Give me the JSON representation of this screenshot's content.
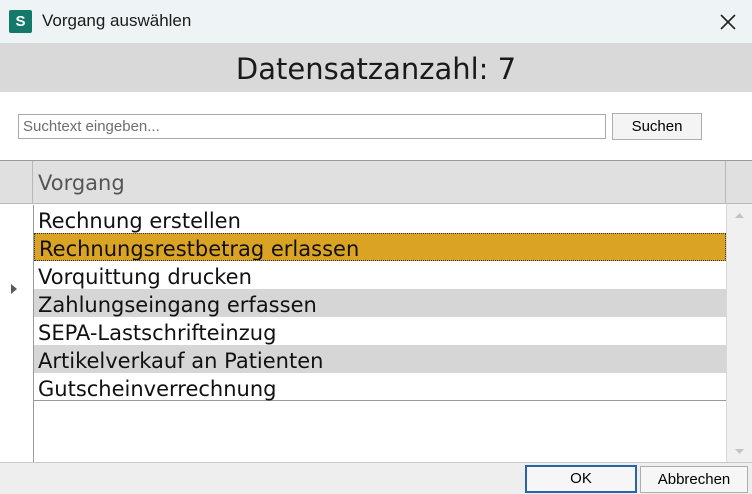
{
  "window": {
    "app_icon_letter": "S",
    "title": "Vorgang auswählen"
  },
  "header": {
    "record_count": "Datensatzanzahl: 7"
  },
  "search": {
    "placeholder": "Suchtext eingeben...",
    "value": "",
    "button_label": "Suchen"
  },
  "grid": {
    "column_header": "Vorgang",
    "selected_index": 1,
    "rows": [
      "Rechnung erstellen",
      "Rechnungsrestbetrag erlassen",
      "Vorquittung drucken",
      "Zahlungseingang erfassen",
      "SEPA-Lastschrifteinzug",
      "Artikelverkauf an Patienten",
      "Gutscheinverrechnung"
    ]
  },
  "footer": {
    "ok_label": "OK",
    "cancel_label": "Abbrechen"
  },
  "colors": {
    "accent_icon": "#14796b",
    "selection": "#dba323",
    "alternate_row": "#d6d6d6",
    "ok_border": "#2a64a8"
  }
}
